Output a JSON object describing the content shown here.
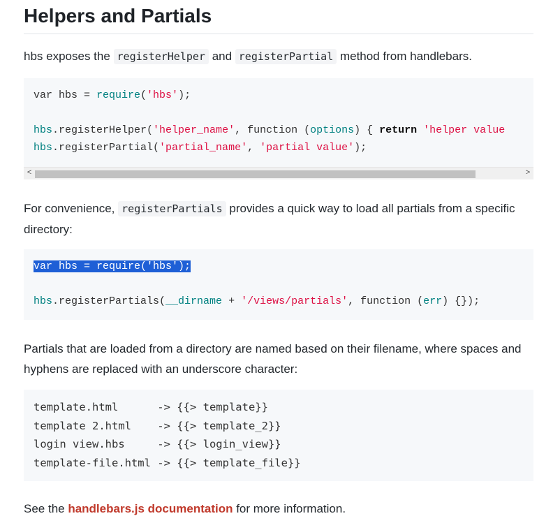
{
  "heading": "Helpers and Partials",
  "p1": {
    "before": "hbs exposes the ",
    "code1": "registerHelper",
    "middle": " and ",
    "code2": "registerPartial",
    "after": " method from handlebars."
  },
  "code1": {
    "line1": {
      "a": "var hbs = ",
      "b": "require",
      "c": "(",
      "d": "'hbs'",
      "e": ");"
    },
    "line3": {
      "a": "hbs",
      "b": ".registerHelper(",
      "c": "'helper_name'",
      "d": ", function (",
      "e": "options",
      "f": ") { ",
      "g": "return",
      "h": " ",
      "i": "'helper value"
    },
    "line4": {
      "a": "hbs",
      "b": ".registerPartial(",
      "c": "'partial_name'",
      "d": ", ",
      "e": "'partial value'",
      "f": ");"
    },
    "scroll_left": "<",
    "scroll_right": ">"
  },
  "p2": {
    "before": "For convenience, ",
    "code": "registerPartials",
    "after": " provides a quick way to load all partials from a specific directory:"
  },
  "code2": {
    "line1": "var hbs = require('hbs');",
    "line3": {
      "a": "hbs",
      "b": ".registerPartials(",
      "c": "__dirname",
      "d": " + ",
      "e": "'/views/partials'",
      "f": ", function (",
      "g": "err",
      "h": ") {});"
    }
  },
  "p3": "Partials that are loaded from a directory are named based on their filename, where spaces and hyphens are replaced with an underscore character:",
  "code3": {
    "lines": [
      "template.html      -> {{> template}}",
      "template 2.html    -> {{> template_2}}",
      "login view.hbs     -> {{> login_view}}",
      "template-file.html -> {{> template_file}}"
    ]
  },
  "p4": {
    "before": "See the ",
    "link": "handlebars.js documentation",
    "after": " for more information."
  }
}
